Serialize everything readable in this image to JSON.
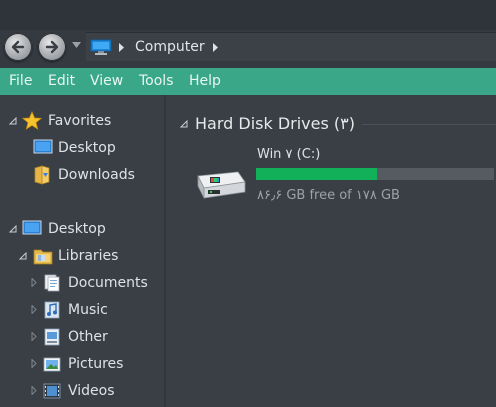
{
  "window": {
    "breadcrumb": {
      "location": "Computer"
    }
  },
  "menu": {
    "file": "File",
    "edit": "Edit",
    "view": "View",
    "tools": "Tools",
    "help": "Help"
  },
  "sidebar": {
    "favorites": {
      "label": "Favorites",
      "items": [
        {
          "label": "Desktop"
        },
        {
          "label": "Downloads"
        }
      ]
    },
    "desktop": {
      "label": "Desktop",
      "libraries": {
        "label": "Libraries",
        "items": [
          {
            "label": "Documents"
          },
          {
            "label": "Music"
          },
          {
            "label": "Other"
          },
          {
            "label": "Pictures"
          },
          {
            "label": "Videos"
          }
        ]
      }
    }
  },
  "content": {
    "group_title": "Hard Disk Drives (۳)",
    "drives": [
      {
        "name": "Win ۷ (C:)",
        "free_text": "۸۶٫۶ GB free of ۱۷۸ GB",
        "used_fraction": 0.51
      }
    ]
  },
  "colors": {
    "menubar": "#3aa888",
    "usage_fill": "#13b05a",
    "background": "#3a3f46"
  }
}
